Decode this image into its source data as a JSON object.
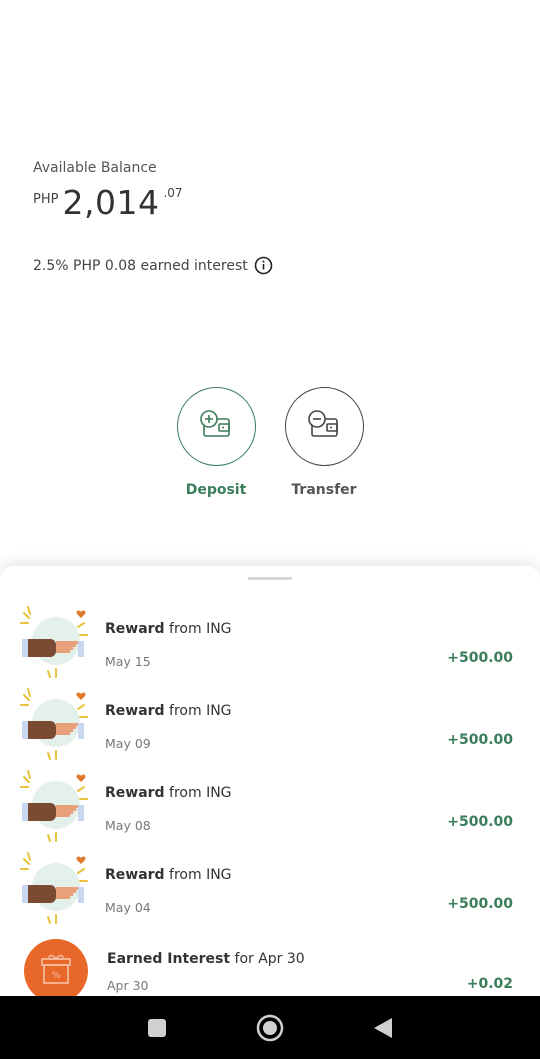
{
  "balance": {
    "label": "Available Balance",
    "currency": "PHP",
    "amount": "2,014",
    "cents": ".07"
  },
  "interest": {
    "text": "2.5% PHP 0.08 earned interest"
  },
  "actions": {
    "deposit_label": "Deposit",
    "transfer_label": "Transfer"
  },
  "transactions": [
    {
      "bold": "Reward",
      "rest": " from ING",
      "date": "May 15",
      "amount": "+500.00",
      "icon": "reward-icon"
    },
    {
      "bold": "Reward",
      "rest": " from ING",
      "date": "May 09",
      "amount": "+500.00",
      "icon": "reward-icon"
    },
    {
      "bold": "Reward",
      "rest": " from ING",
      "date": "May 08",
      "amount": "+500.00",
      "icon": "reward-icon"
    },
    {
      "bold": "Reward",
      "rest": " from ING",
      "date": "May 04",
      "amount": "+500.00",
      "icon": "reward-icon"
    },
    {
      "bold": "Earned Interest",
      "rest": " for Apr 30",
      "date": "Apr 30",
      "amount": "+0.02",
      "icon": "interest-gift-icon"
    }
  ],
  "colors": {
    "accent_green": "#3a7d5a",
    "interest_orange": "#e8682a"
  },
  "nav": {
    "icons": [
      "recents-icon",
      "home-icon",
      "back-icon"
    ]
  }
}
